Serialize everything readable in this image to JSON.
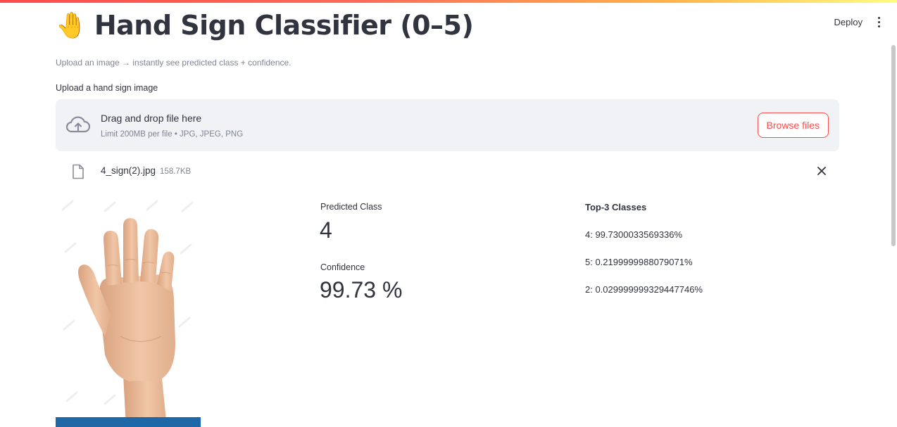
{
  "header": {
    "deploy_label": "Deploy"
  },
  "page": {
    "title_emoji": "🤚",
    "title": "Hand Sign Classifier (0–5)",
    "caption": "Upload an image → instantly see predicted class + confidence."
  },
  "uploader": {
    "label": "Upload a hand sign image",
    "dropzone_title": "Drag and drop file here",
    "dropzone_limit": "Limit 200MB per file • JPG, JPEG, PNG",
    "browse_label": "Browse files"
  },
  "file": {
    "name": "4_sign(2).jpg",
    "size": "158.7KB"
  },
  "prediction": {
    "predicted_label": "Predicted Class",
    "predicted_value": "4",
    "confidence_label": "Confidence",
    "confidence_value": "99.73 %"
  },
  "top3": {
    "title": "Top-3 Classes",
    "items": [
      "4: 99.7300033569336%",
      "5: 0.2199999988079071%",
      "2: 0.029999999329447746%"
    ]
  },
  "colors": {
    "accent": "#ff4b4b",
    "dropzone_bg": "#f0f2f6",
    "text": "#31333f",
    "muted": "#808495"
  },
  "icons": {
    "upload": "cloud-upload-icon",
    "file": "file-icon",
    "close": "close-icon",
    "menu": "kebab-menu-icon"
  }
}
